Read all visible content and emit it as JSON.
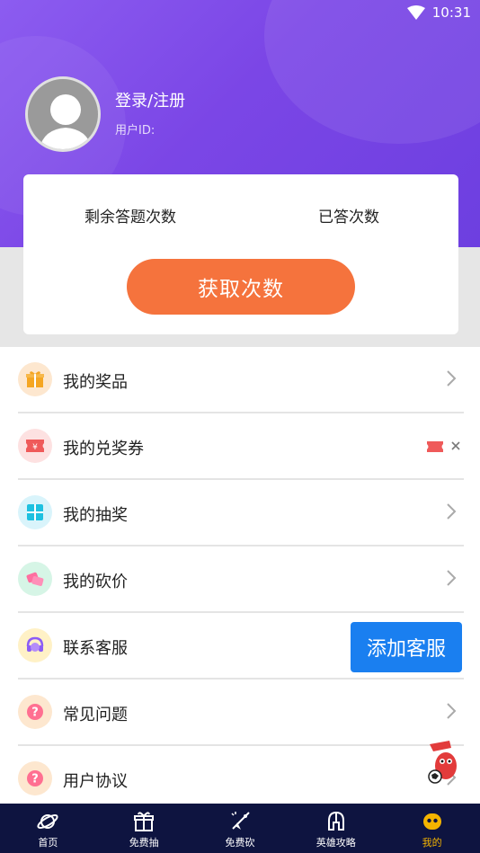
{
  "status_bar": {
    "time": "10:31",
    "wifi_icon": "wifi-icon"
  },
  "profile": {
    "login_label": "登录/注册",
    "user_id_label": "用户ID:"
  },
  "stats": {
    "remaining_label": "剩余答题次数",
    "answered_label": "已答次数",
    "get_button": "获取次数"
  },
  "menu": {
    "items": [
      {
        "label": "我的奖品",
        "icon": "gift-icon",
        "icon_bg": "#fde7cf",
        "icon_color": "#f5a623"
      },
      {
        "label": "我的兑奖券",
        "icon": "coupon-icon",
        "icon_bg": "#fde1e1",
        "icon_color": "#ef5a5a"
      },
      {
        "label": "我的抽奖",
        "icon": "lottery-icon",
        "icon_bg": "#d9f4fb",
        "icon_color": "#1fc1e0"
      },
      {
        "label": "我的砍价",
        "icon": "bargain-icon",
        "icon_bg": "#d6f5e6",
        "icon_color": "#ff6fa0"
      },
      {
        "label": "联系客服",
        "icon": "headset-icon",
        "icon_bg": "#fff1c6",
        "icon_color": "#8b5cf6"
      },
      {
        "label": "常见问题",
        "icon": "question-icon",
        "icon_bg": "#fde7cf",
        "icon_color": "#ff6f91"
      },
      {
        "label": "用户协议",
        "icon": "question-icon",
        "icon_bg": "#fde7cf",
        "icon_color": "#ff6f91"
      }
    ],
    "add_service_button": "添加客服"
  },
  "tabbar": {
    "tabs": [
      {
        "label": "首页",
        "icon": "planet-icon"
      },
      {
        "label": "免费抽",
        "icon": "gift-icon"
      },
      {
        "label": "免费砍",
        "icon": "rocket-icon"
      },
      {
        "label": "英雄攻略",
        "icon": "helmet-icon"
      },
      {
        "label": "我的",
        "icon": "face-icon",
        "active": true
      }
    ]
  },
  "colors": {
    "header_purple": "#7b46e6",
    "accent_orange": "#f5733d",
    "button_blue": "#1a7ff0",
    "tabbar_bg": "#0e1440",
    "active_tab": "#f4b400"
  }
}
